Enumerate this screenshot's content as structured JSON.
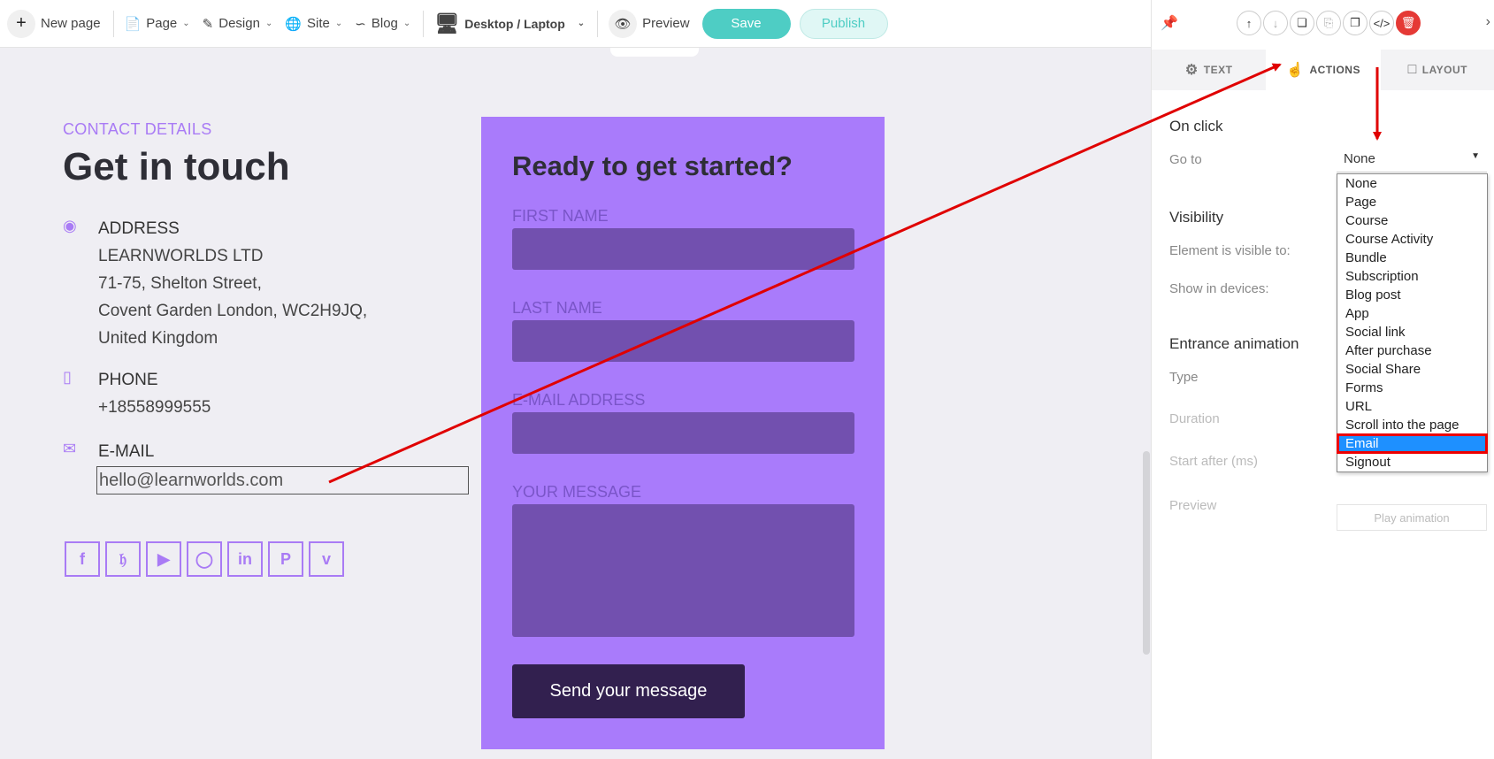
{
  "toolbar": {
    "new_page": "New page",
    "page": "Page",
    "design": "Design",
    "site": "Site",
    "blog": "Blog",
    "device": "Desktop / Laptop",
    "preview": "Preview",
    "save": "Save",
    "publish": "Publish"
  },
  "contact": {
    "label": "CONTACT DETAILS",
    "title": "Get in touch",
    "address_head": "ADDRESS",
    "address_lines": [
      "LEARNWORLDS LTD",
      "71-75, Shelton Street,",
      "Covent Garden London, WC2H9JQ,",
      "United Kingdom"
    ],
    "phone_head": "PHONE",
    "phone": "+18558999555",
    "email_head": "E-MAIL",
    "email": "hello@learnworlds.com",
    "socials": [
      "facebook-icon",
      "twitter-icon",
      "youtube-icon",
      "instagram-icon",
      "linkedin-icon",
      "pinterest-icon",
      "vimeo-icon"
    ]
  },
  "form": {
    "title": "Ready to get started?",
    "first_name": "FIRST NAME",
    "last_name": "LAST NAME",
    "email": "E-MAIL ADDRESS",
    "message": "YOUR MESSAGE",
    "submit": "Send your message"
  },
  "panel": {
    "tabs": [
      "TEXT",
      "ACTIONS",
      "LAYOUT"
    ],
    "on_click": "On click",
    "go_to": "Go to",
    "go_to_value": "None",
    "visibility": "Visibility",
    "visible_to": "Element is visible to:",
    "show_devices": "Show in devices:",
    "entrance": "Entrance animation",
    "type": "Type",
    "duration": "Duration",
    "start_after": "Start after (ms)",
    "preview": "Preview",
    "play_animation": "Play animation",
    "options": [
      "None",
      "Page",
      "Course",
      "Course Activity",
      "Bundle",
      "Subscription",
      "Blog post",
      "App",
      "Social link",
      "After purchase",
      "Social Share",
      "Forms",
      "URL",
      "Scroll into the page",
      "Email",
      "Signout"
    ],
    "selected_option": "Email"
  },
  "colors": {
    "accent": "#a97bf5",
    "teal": "#4ecdc4",
    "annotation": "#e00000"
  }
}
